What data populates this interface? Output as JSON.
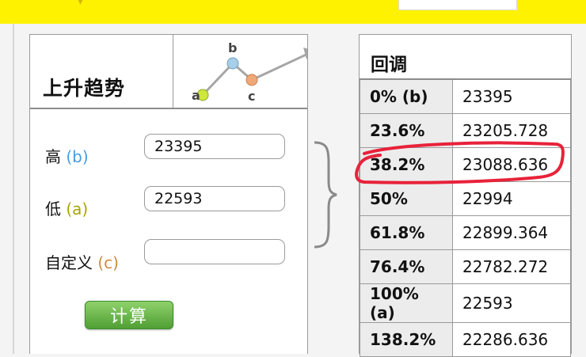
{
  "calculator": {
    "title": "上升趋势",
    "fields": {
      "high": {
        "label": "高",
        "key": "(b)",
        "value": "23395"
      },
      "low": {
        "label": "低",
        "key": "(a)",
        "value": "22593"
      },
      "custom": {
        "label": "自定义",
        "key": "(c)",
        "value": ""
      }
    },
    "calc_button_label": "计算",
    "icon_labels": {
      "a": "a",
      "b": "b",
      "c": "c"
    }
  },
  "retracement": {
    "title": "回调",
    "rows": [
      {
        "level": "0% (b)",
        "value": "23395"
      },
      {
        "level": "23.6%",
        "value": "23205.728"
      },
      {
        "level": "38.2%",
        "value": "23088.636"
      },
      {
        "level": "50%",
        "value": "22994"
      },
      {
        "level": "61.8%",
        "value": "22899.364"
      },
      {
        "level": "76.4%",
        "value": "22782.272"
      },
      {
        "level": "100% (a)",
        "value": "22593"
      },
      {
        "level": "138.2%",
        "value": "22286.636"
      }
    ]
  },
  "colors": {
    "top_bar": "#fff200",
    "button_green": "#5aaa3a",
    "highlight_red": "#e8223a",
    "point_a": "#cfe73a",
    "point_b": "#a8cfe8",
    "point_c": "#f0a878"
  }
}
